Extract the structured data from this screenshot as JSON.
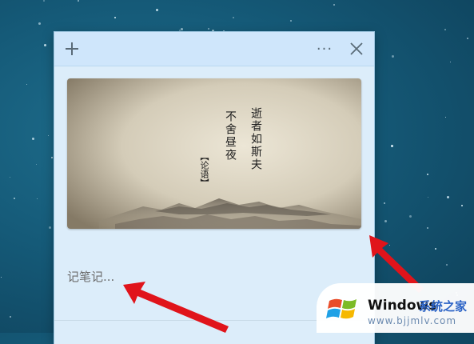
{
  "window": {
    "add_icon": "plus-icon",
    "more_icon": "ellipsis-icon",
    "more_label": "···",
    "close_icon": "close-icon"
  },
  "note": {
    "placeholder": "记笔记...",
    "image": {
      "poem_line_1": "逝者如斯夫",
      "poem_line_2": "不舍昼夜",
      "source": "【论语】"
    }
  },
  "watermark": {
    "brand": "Windows",
    "site": "系统之家",
    "url": "www.bjjmlv.com"
  },
  "colors": {
    "accent_arrow": "#e0141b",
    "titlebar": "#cfe6fb",
    "note_bg": "#dcedfa"
  }
}
